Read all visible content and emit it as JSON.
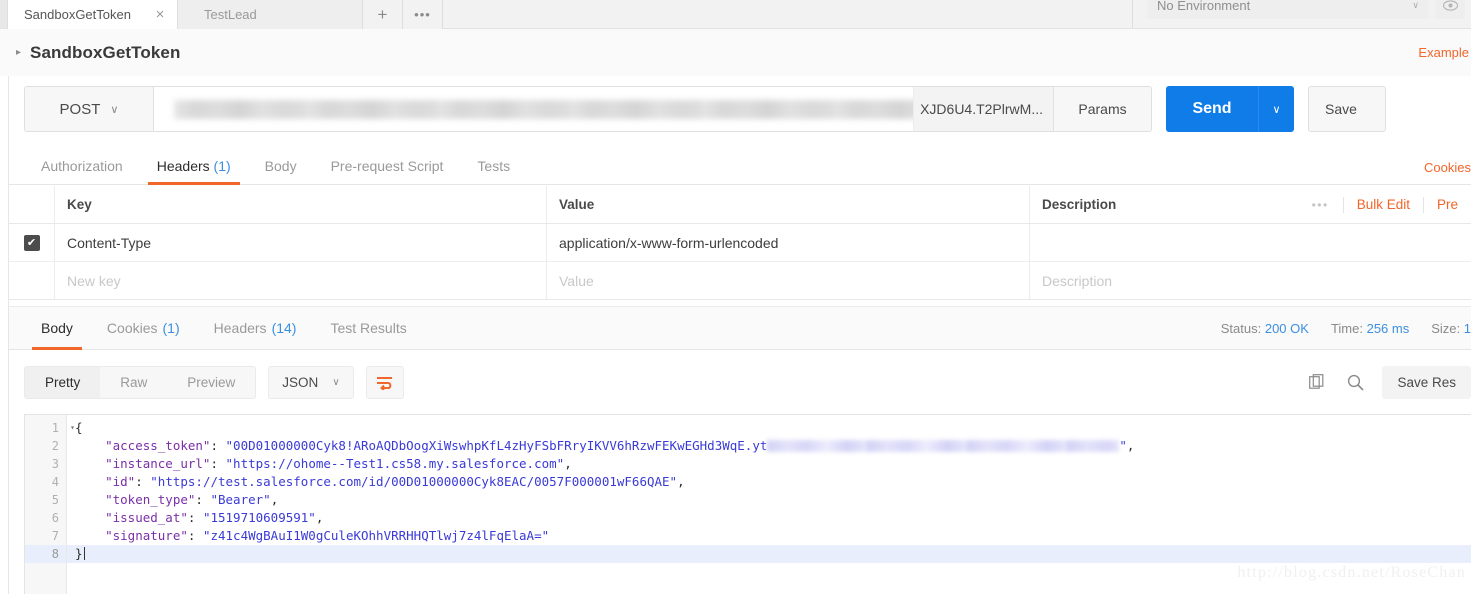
{
  "tabstrip": {
    "tabs": [
      {
        "title": "SandboxGetToken",
        "active": true,
        "close": "×"
      },
      {
        "title": "TestLead",
        "active": false,
        "close": ""
      }
    ],
    "new_tab_label": "+",
    "more_label": "•••",
    "environment": {
      "selected": "No Environment",
      "caret": "∨"
    }
  },
  "request_header": {
    "collapse_arrow": "▸",
    "title": "SandboxGetToken",
    "examples_link": "Example"
  },
  "url_bar": {
    "method": "POST",
    "method_caret": "∨",
    "url_visible_tail": "XJD6U4.T2PlrwM...",
    "params_label": "Params",
    "send_label": "Send",
    "send_caret": "∨",
    "save_label": "Save"
  },
  "request_tabs": {
    "items": [
      {
        "label": "Authorization",
        "count": "",
        "active": false
      },
      {
        "label": "Headers",
        "count": "(1)",
        "active": true
      },
      {
        "label": "Body",
        "count": "",
        "active": false
      },
      {
        "label": "Pre-request Script",
        "count": "",
        "active": false
      },
      {
        "label": "Tests",
        "count": "",
        "active": false
      }
    ],
    "cookies_link": "Cookies"
  },
  "headers_table": {
    "columns": {
      "key": "Key",
      "value": "Value",
      "description": "Description"
    },
    "actions": {
      "dots": "•••",
      "bulk_edit": "Bulk Edit",
      "presets": "Pre"
    },
    "rows": [
      {
        "checked": true,
        "check_glyph": "✔",
        "key": "Content-Type",
        "value": "application/x-www-form-urlencoded",
        "description": ""
      }
    ],
    "new_row": {
      "key_placeholder": "New key",
      "value_placeholder": "Value",
      "description_placeholder": "Description"
    }
  },
  "response_tabs": {
    "items": [
      {
        "label": "Body",
        "count": "",
        "active": true
      },
      {
        "label": "Cookies",
        "count": "(1)",
        "active": false
      },
      {
        "label": "Headers",
        "count": "(14)",
        "active": false
      },
      {
        "label": "Test Results",
        "count": "",
        "active": false
      }
    ],
    "status": {
      "status_label": "Status:",
      "status_value": "200 OK",
      "time_label": "Time:",
      "time_value": "256 ms",
      "size_label": "Size:",
      "size_value": "1"
    }
  },
  "body_toolbar": {
    "formats": [
      {
        "label": "Pretty",
        "active": true
      },
      {
        "label": "Raw",
        "active": false
      },
      {
        "label": "Preview",
        "active": false
      }
    ],
    "language": "JSON",
    "language_caret": "∨",
    "wrap_icon": "word-wrap-icon",
    "copy_icon": "copy-icon",
    "search_icon": "search-icon",
    "save_response_label": "Save Res"
  },
  "editor": {
    "line_numbers": [
      "1",
      "2",
      "3",
      "4",
      "5",
      "6",
      "7",
      "8"
    ],
    "fold_arrow": "▾",
    "current_line": 8,
    "lines": [
      {
        "n": 1,
        "segments": [
          {
            "t": "p",
            "text": "{"
          }
        ]
      },
      {
        "n": 2,
        "segments": [
          {
            "t": "k",
            "text": "    \"access_token\""
          },
          {
            "t": "p",
            "text": ": "
          },
          {
            "t": "s",
            "text": "\"00D01000000Cyk8!ARoAQDbOogXiWswhpKfL4zHyFSbFRryIKVV6hRzwFEKwEGHd3WqE.yt"
          },
          {
            "t": "blur",
            "text": ""
          },
          {
            "t": "s",
            "text": "\""
          },
          {
            "t": "p",
            "text": ","
          }
        ]
      },
      {
        "n": 3,
        "segments": [
          {
            "t": "k",
            "text": "    \"instance_url\""
          },
          {
            "t": "p",
            "text": ": "
          },
          {
            "t": "s",
            "text": "\"https://ohome--Test1.cs58.my.salesforce.com\""
          },
          {
            "t": "p",
            "text": ","
          }
        ]
      },
      {
        "n": 4,
        "segments": [
          {
            "t": "k",
            "text": "    \"id\""
          },
          {
            "t": "p",
            "text": ": "
          },
          {
            "t": "s",
            "text": "\"https://test.salesforce.com/id/00D01000000Cyk8EAC/0057F000001wF66QAE\""
          },
          {
            "t": "p",
            "text": ","
          }
        ]
      },
      {
        "n": 5,
        "segments": [
          {
            "t": "k",
            "text": "    \"token_type\""
          },
          {
            "t": "p",
            "text": ": "
          },
          {
            "t": "s",
            "text": "\"Bearer\""
          },
          {
            "t": "p",
            "text": ","
          }
        ]
      },
      {
        "n": 6,
        "segments": [
          {
            "t": "k",
            "text": "    \"issued_at\""
          },
          {
            "t": "p",
            "text": ": "
          },
          {
            "t": "s",
            "text": "\"1519710609591\""
          },
          {
            "t": "p",
            "text": ","
          }
        ]
      },
      {
        "n": 7,
        "segments": [
          {
            "t": "k",
            "text": "    \"signature\""
          },
          {
            "t": "p",
            "text": ": "
          },
          {
            "t": "s",
            "text": "\"z41c4WgBAuI1W0gCuleKOhhVRRHHQTlwj7z4lFqElaA=\""
          }
        ]
      },
      {
        "n": 8,
        "segments": [
          {
            "t": "p",
            "text": "}"
          },
          {
            "t": "caret",
            "text": ""
          }
        ]
      }
    ]
  },
  "watermark": "http://blog.csdn.net/RoseChan",
  "colors": {
    "accent_orange": "#f1662a",
    "send_blue": "#0f7ce8",
    "link_blue": "#3c8fe0",
    "json_key": "#7a2fa8",
    "json_string": "#3a3ad6"
  }
}
